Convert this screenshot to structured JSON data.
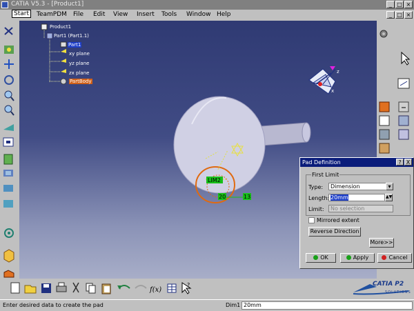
{
  "window": {
    "title": "CATIA V5.3 - [Product1]"
  },
  "menu": [
    "Start",
    "TeamPDM",
    "File",
    "Edit",
    "View",
    "Insert",
    "Tools",
    "Window",
    "Help"
  ],
  "tree": {
    "root": "Product1",
    "part": "Part1 (Part1.1)",
    "body": "Part1",
    "planes": [
      "xy plane",
      "yz plane",
      "zx plane"
    ],
    "partbody": "PartBody"
  },
  "canvas": {
    "sketch_label": "LIM2",
    "dim_20": "20",
    "dim_13": "13",
    "compass_axis_x": "x",
    "compass_axis_z": "z"
  },
  "dialog": {
    "title": "Pad Definition",
    "help": "?",
    "close": "X",
    "group_label": "First Limit",
    "type_label": "Type:",
    "type_value": "Dimension",
    "length_label": "Length:",
    "length_value": "20mm",
    "limit_label": "Limit:",
    "limit_value": "No selection",
    "mirrored_label": "Mirrored extent",
    "reverse_label": "Reverse Direction",
    "more_label": "More>>",
    "ok_label": "OK",
    "apply_label": "Apply",
    "cancel_label": "Cancel"
  },
  "brand": {
    "name": "CATIA P2",
    "sub": "SOLUTIONS"
  },
  "status": {
    "message": "Enter desired data to create the pad",
    "dim_label": "Dim1",
    "dim_value": "20mm"
  },
  "colors": {
    "sky_top": "#2f3a73",
    "sky_bottom": "#a8aec8",
    "dialog_title": "#0a1c7a",
    "sketch_orange": "#e06a10",
    "constraint_green": "#18c018"
  }
}
